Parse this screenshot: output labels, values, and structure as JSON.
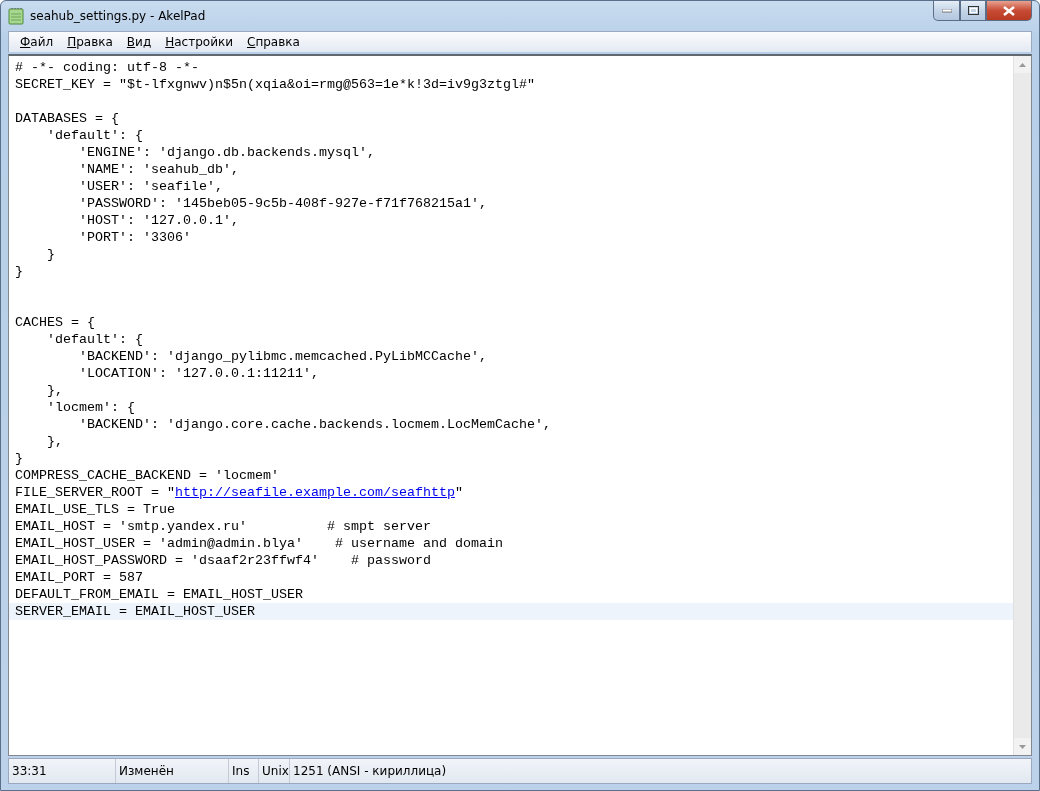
{
  "window": {
    "title": "seahub_settings.py - AkelPad"
  },
  "menu": [
    {
      "label": "Файл"
    },
    {
      "label": "Правка"
    },
    {
      "label": "Вид"
    },
    {
      "label": "Настройки"
    },
    {
      "label": "Справка"
    }
  ],
  "editor": {
    "lines": [
      {
        "current": false,
        "parts": [
          {
            "kind": "code",
            "text": "# -*- coding: utf-8 -*-"
          }
        ]
      },
      {
        "current": false,
        "parts": [
          {
            "kind": "code",
            "text": "SECRET_KEY = \"$t-lfxgnwv)n$5n(xqia&oi=rmg@563=1e*k!3d=iv9g3ztgl#\""
          }
        ]
      },
      {
        "current": false
      },
      {
        "current": false,
        "parts": [
          {
            "kind": "code",
            "text": "DATABASES = {"
          }
        ]
      },
      {
        "current": false,
        "parts": [
          {
            "kind": "code",
            "text": "    'default': {"
          }
        ]
      },
      {
        "current": false,
        "parts": [
          {
            "kind": "code",
            "text": "        'ENGINE': 'django.db.backends.mysql',"
          }
        ]
      },
      {
        "current": false,
        "parts": [
          {
            "kind": "code",
            "text": "        'NAME': 'seahub_db',"
          }
        ]
      },
      {
        "current": false,
        "parts": [
          {
            "kind": "code",
            "text": "        'USER': 'seafile',"
          }
        ]
      },
      {
        "current": false,
        "parts": [
          {
            "kind": "code",
            "text": "        'PASSWORD': '145beb05-9c5b-408f-927e-f71f768215a1',"
          }
        ]
      },
      {
        "current": false,
        "parts": [
          {
            "kind": "code",
            "text": "        'HOST': '127.0.0.1',"
          }
        ]
      },
      {
        "current": false,
        "parts": [
          {
            "kind": "code",
            "text": "        'PORT': '3306'"
          }
        ]
      },
      {
        "current": false,
        "parts": [
          {
            "kind": "code",
            "text": "    }"
          }
        ]
      },
      {
        "current": false,
        "parts": [
          {
            "kind": "code",
            "text": "}"
          }
        ]
      },
      {
        "current": false
      },
      {
        "current": false
      },
      {
        "current": false,
        "parts": [
          {
            "kind": "code",
            "text": "CACHES = {"
          }
        ]
      },
      {
        "current": false,
        "parts": [
          {
            "kind": "code",
            "text": "    'default': {"
          }
        ]
      },
      {
        "current": false,
        "parts": [
          {
            "kind": "code",
            "text": "        'BACKEND': 'django_pylibmc.memcached.PyLibMCCache',"
          }
        ]
      },
      {
        "current": false,
        "parts": [
          {
            "kind": "code",
            "text": "        'LOCATION': '127.0.0.1:11211',"
          }
        ]
      },
      {
        "current": false,
        "parts": [
          {
            "kind": "code",
            "text": "    },"
          }
        ]
      },
      {
        "current": false,
        "parts": [
          {
            "kind": "code",
            "text": "    'locmem': {"
          }
        ]
      },
      {
        "current": false,
        "parts": [
          {
            "kind": "code",
            "text": "        'BACKEND': 'django.core.cache.backends.locmem.LocMemCache',"
          }
        ]
      },
      {
        "current": false,
        "parts": [
          {
            "kind": "code",
            "text": "    },"
          }
        ]
      },
      {
        "current": false,
        "parts": [
          {
            "kind": "code",
            "text": "}"
          }
        ]
      },
      {
        "current": false,
        "parts": [
          {
            "kind": "code",
            "text": "COMPRESS_CACHE_BACKEND = 'locmem'"
          }
        ]
      },
      {
        "current": false,
        "parts": [
          {
            "kind": "code",
            "text": "FILE_SERVER_ROOT = \""
          },
          {
            "kind": "link",
            "text": "http://seafile.example.com/seafhttp"
          },
          {
            "kind": "code",
            "text": "\""
          }
        ]
      },
      {
        "current": false,
        "parts": [
          {
            "kind": "code",
            "text": "EMAIL_USE_TLS = True"
          }
        ]
      },
      {
        "current": false,
        "parts": [
          {
            "kind": "code",
            "text": "EMAIL_HOST = 'smtp.yandex.ru'          # smpt server"
          }
        ]
      },
      {
        "current": false,
        "parts": [
          {
            "kind": "code",
            "text": "EMAIL_HOST_USER = 'admin@admin.blya'    # username and domain"
          }
        ]
      },
      {
        "current": false,
        "parts": [
          {
            "kind": "code",
            "text": "EMAIL_HOST_PASSWORD = 'dsaaf2r23ffwf4'    # password"
          }
        ]
      },
      {
        "current": false,
        "parts": [
          {
            "kind": "code",
            "text": "EMAIL_PORT = 587"
          }
        ]
      },
      {
        "current": false,
        "parts": [
          {
            "kind": "code",
            "text": "DEFAULT_FROM_EMAIL = EMAIL_HOST_USER"
          }
        ]
      },
      {
        "current": true,
        "parts": [
          {
            "kind": "code",
            "text": "SERVER_EMAIL = EMAIL_HOST_USER"
          }
        ]
      }
    ]
  },
  "status_bar": [
    {
      "text": "33:31"
    },
    {
      "text": "Изменён"
    },
    {
      "text": "Ins"
    },
    {
      "text": "Unix"
    },
    {
      "text": "1251  (ANSI - кириллица)"
    }
  ]
}
